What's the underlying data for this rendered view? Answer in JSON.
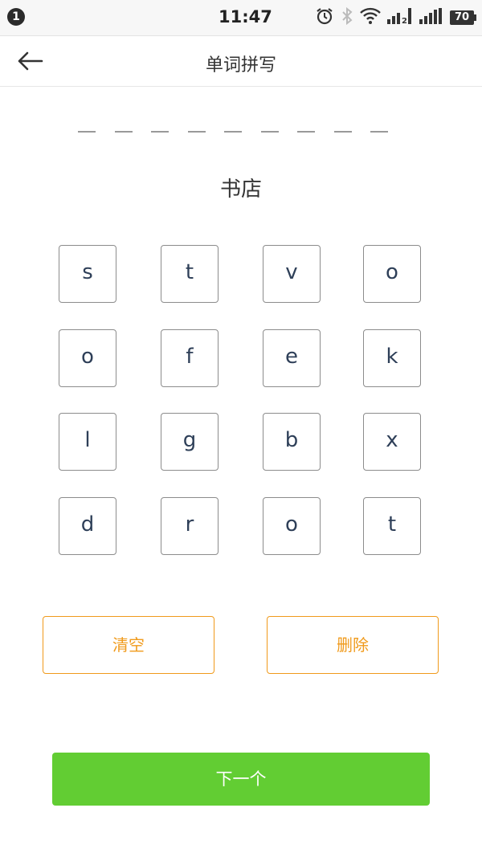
{
  "status_bar": {
    "notification_count": "1",
    "time": "11:47",
    "icons": [
      "alarm-icon",
      "bluetooth-icon",
      "wifi-icon",
      "signal-icon",
      "signal-icon"
    ],
    "sim2_label": "2",
    "battery": "70"
  },
  "header": {
    "back_icon": "arrow-left-icon",
    "title": "单词拼写"
  },
  "answer": {
    "slot_count": 9
  },
  "hint": "书店",
  "letters": [
    "s",
    "t",
    "v",
    "o",
    "o",
    "f",
    "e",
    "k",
    "l",
    "g",
    "b",
    "x",
    "d",
    "r",
    "o",
    "t"
  ],
  "actions": {
    "clear_label": "清空",
    "delete_label": "删除"
  },
  "next_label": "下一个",
  "colors": {
    "accent_orange": "#f09a1b",
    "next_green": "#62cd33",
    "key_text": "#2e3f58"
  }
}
